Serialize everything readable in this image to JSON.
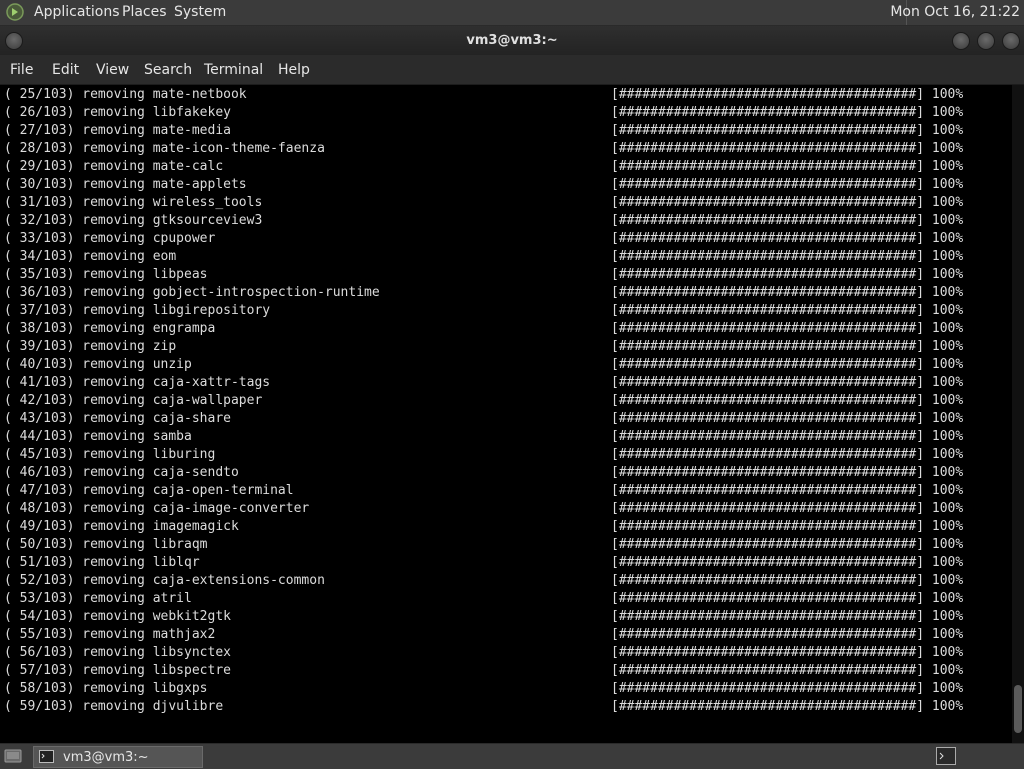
{
  "top_panel": {
    "menus": [
      "Applications",
      "Places",
      "System"
    ],
    "clock": "Mon Oct 16, 21:22"
  },
  "window": {
    "title": "vm3@vm3:~",
    "menus": [
      "File",
      "Edit",
      "View",
      "Search",
      "Terminal",
      "Help"
    ]
  },
  "terminal": {
    "lines": [
      {
        "left": "( 25/103) removing mate-netbook",
        "right": "[######################################] 100%"
      },
      {
        "left": "( 26/103) removing libfakekey",
        "right": "[######################################] 100%"
      },
      {
        "left": "( 27/103) removing mate-media",
        "right": "[######################################] 100%"
      },
      {
        "left": "( 28/103) removing mate-icon-theme-faenza",
        "right": "[######################################] 100%"
      },
      {
        "left": "( 29/103) removing mate-calc",
        "right": "[######################################] 100%"
      },
      {
        "left": "( 30/103) removing mate-applets",
        "right": "[######################################] 100%"
      },
      {
        "left": "( 31/103) removing wireless_tools",
        "right": "[######################################] 100%"
      },
      {
        "left": "( 32/103) removing gtksourceview3",
        "right": "[######################################] 100%"
      },
      {
        "left": "( 33/103) removing cpupower",
        "right": "[######################################] 100%"
      },
      {
        "left": "( 34/103) removing eom",
        "right": "[######################################] 100%"
      },
      {
        "left": "( 35/103) removing libpeas",
        "right": "[######################################] 100%"
      },
      {
        "left": "( 36/103) removing gobject-introspection-runtime",
        "right": "[######################################] 100%"
      },
      {
        "left": "( 37/103) removing libgirepository",
        "right": "[######################################] 100%"
      },
      {
        "left": "( 38/103) removing engrampa",
        "right": "[######################################] 100%"
      },
      {
        "left": "( 39/103) removing zip",
        "right": "[######################################] 100%"
      },
      {
        "left": "( 40/103) removing unzip",
        "right": "[######################################] 100%"
      },
      {
        "left": "( 41/103) removing caja-xattr-tags",
        "right": "[######################################] 100%"
      },
      {
        "left": "( 42/103) removing caja-wallpaper",
        "right": "[######################################] 100%"
      },
      {
        "left": "( 43/103) removing caja-share",
        "right": "[######################################] 100%"
      },
      {
        "left": "( 44/103) removing samba",
        "right": "[######################################] 100%"
      },
      {
        "left": "( 45/103) removing liburing",
        "right": "[######################################] 100%"
      },
      {
        "left": "( 46/103) removing caja-sendto",
        "right": "[######################################] 100%"
      },
      {
        "left": "( 47/103) removing caja-open-terminal",
        "right": "[######################################] 100%"
      },
      {
        "left": "( 48/103) removing caja-image-converter",
        "right": "[######################################] 100%"
      },
      {
        "left": "( 49/103) removing imagemagick",
        "right": "[######################################] 100%"
      },
      {
        "left": "( 50/103) removing libraqm",
        "right": "[######################################] 100%"
      },
      {
        "left": "( 51/103) removing liblqr",
        "right": "[######################################] 100%"
      },
      {
        "left": "( 52/103) removing caja-extensions-common",
        "right": "[######################################] 100%"
      },
      {
        "left": "( 53/103) removing atril",
        "right": "[######################################] 100%"
      },
      {
        "left": "( 54/103) removing webkit2gtk",
        "right": "[######################################] 100%"
      },
      {
        "left": "( 55/103) removing mathjax2",
        "right": "[######################################] 100%"
      },
      {
        "left": "( 56/103) removing libsynctex",
        "right": "[######################################] 100%"
      },
      {
        "left": "( 57/103) removing libspectre",
        "right": "[######################################] 100%"
      },
      {
        "left": "( 58/103) removing libgxps",
        "right": "[######################################] 100%"
      },
      {
        "left": "( 59/103) removing djvulibre",
        "right": "[######################################] 100%"
      }
    ]
  },
  "taskbar": {
    "task_label": "vm3@vm3:~"
  },
  "icons": {
    "app_menu": "mate-logo-icon",
    "window_menu": "window-menu-icon",
    "minimize": "minimize-icon",
    "maximize": "maximize-icon",
    "close": "close-icon",
    "show_desktop": "show-desktop-icon",
    "task_terminal": "terminal-icon",
    "workspace": "workspace-terminal-icon"
  },
  "colors": {
    "terminal_bg": "#000000",
    "terminal_fg": "#dcdcdc",
    "panel_bg": "#3b3b3b"
  }
}
